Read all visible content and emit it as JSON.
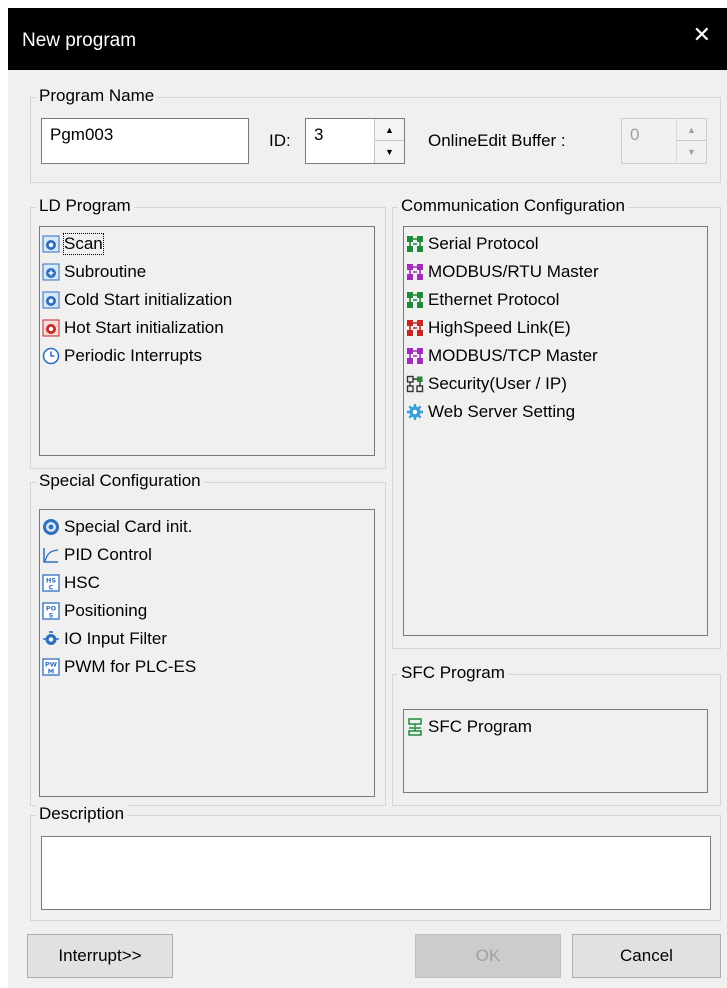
{
  "window": {
    "title": "New program"
  },
  "program_name": {
    "legend": "Program Name",
    "name_value": "Pgm003",
    "id_label": "ID:",
    "id_value": "3",
    "online_label": "OnlineEdit Buffer :",
    "online_value": "0"
  },
  "ld_program": {
    "legend": "LD Program",
    "items": [
      {
        "label": "Scan",
        "icon": "scan-icon",
        "selected": true
      },
      {
        "label": "Subroutine",
        "icon": "subroutine-icon"
      },
      {
        "label": "Cold Start initialization",
        "icon": "cold-start-icon"
      },
      {
        "label": "Hot Start initialization",
        "icon": "hot-start-icon"
      },
      {
        "label": "Periodic Interrupts",
        "icon": "clock-icon"
      }
    ]
  },
  "communication": {
    "legend": "Communication Configuration",
    "items": [
      {
        "label": "Serial Protocol",
        "icon": "network-icon"
      },
      {
        "label": "MODBUS/RTU Master",
        "icon": "network-icon"
      },
      {
        "label": "Ethernet Protocol",
        "icon": "network-icon"
      },
      {
        "label": "HighSpeed Link(E)",
        "icon": "network-icon"
      },
      {
        "label": "MODBUS/TCP Master",
        "icon": "network-icon"
      },
      {
        "label": "Security(User / IP)",
        "icon": "security-network-icon"
      },
      {
        "label": "Web Server Setting",
        "icon": "gear-icon"
      }
    ]
  },
  "special": {
    "legend": "Special Configuration",
    "items": [
      {
        "label": "Special Card init.",
        "icon": "card-icon"
      },
      {
        "label": "PID Control",
        "icon": "pid-icon"
      },
      {
        "label": "HSC",
        "icon": "hsc-icon"
      },
      {
        "label": "Positioning",
        "icon": "pos-icon"
      },
      {
        "label": "IO Input Filter",
        "icon": "filter-icon"
      },
      {
        "label": "PWM for PLC-ES",
        "icon": "pwm-icon"
      }
    ]
  },
  "sfc": {
    "legend": "SFC Program",
    "items": [
      {
        "label": "SFC Program",
        "icon": "sfc-icon"
      }
    ]
  },
  "description": {
    "legend": "Description",
    "value": ""
  },
  "buttons": {
    "interrupt": "Interrupt>>",
    "ok": "OK",
    "cancel": "Cancel"
  },
  "colors": {
    "titlebar": "#000000",
    "dialog_bg": "#f0f0f0",
    "net_green": "#1f8a3a",
    "net_purple": "#a12dbd",
    "net_red": "#c62828",
    "blue": "#2f6fbf"
  }
}
